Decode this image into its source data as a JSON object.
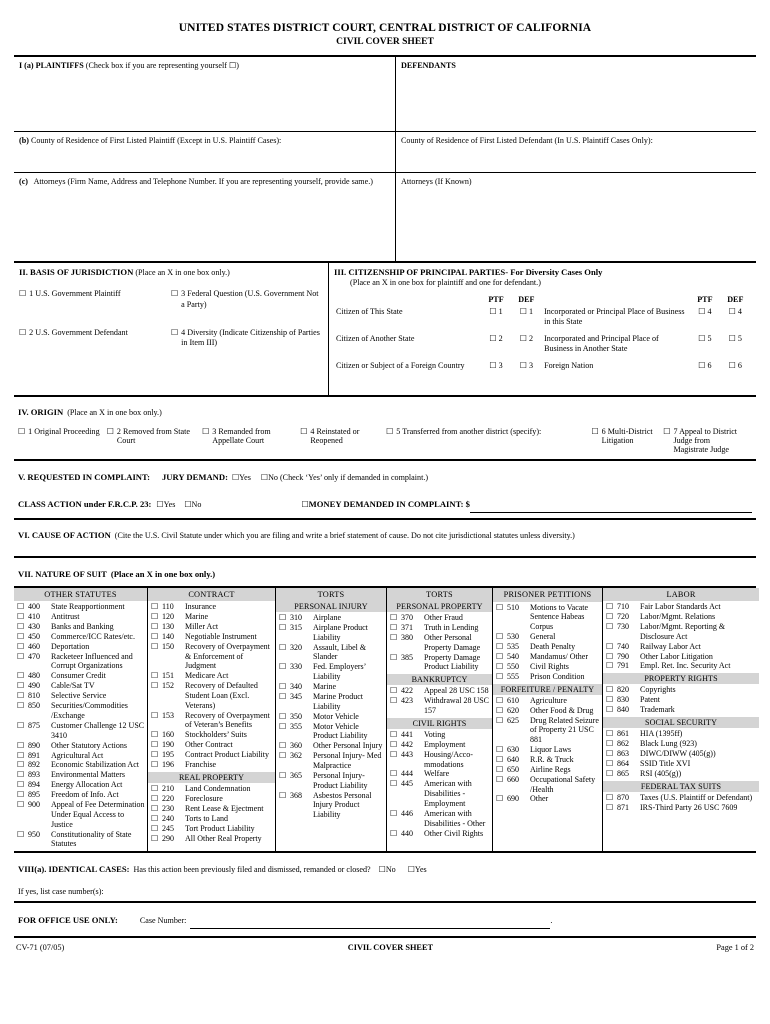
{
  "header": {
    "court": "UNITED STATES DISTRICT COURT, CENTRAL DISTRICT OF CALIFORNIA",
    "form_title": "CIVIL COVER SHEET"
  },
  "section_i": {
    "plaintiffs_label": "I (a) PLAINTIFFS",
    "plaintiffs_note": "(Check box if you are representing yourself ☐)",
    "defendants_label": "DEFENDANTS",
    "b_label": "(b)",
    "b_plaintiff": "County of Residence of First Listed Plaintiff (Except in U.S. Plaintiff Cases):",
    "b_defendant": "County of Residence of First Listed Defendant (In U.S. Plaintiff Cases Only):",
    "c_label": "(c)",
    "c_attorneys": "Attorneys (Firm Name, Address and Telephone Number. If you are representing yourself, provide same.)",
    "c_attorneys_def": "Attorneys (If Known)"
  },
  "section_ii": {
    "title": "II.  BASIS OF JURISDICTION",
    "instruction": "(Place an X in one box only.)",
    "options": [
      {
        "num": "1",
        "label": "U.S. Government Plaintiff"
      },
      {
        "num": "3",
        "label": "Federal Question (U.S. Government Not a Party)"
      },
      {
        "num": "2",
        "label": "U.S. Government Defendant"
      },
      {
        "num": "4",
        "label": "Diversity (Indicate Citizenship of Parties in Item III)"
      }
    ]
  },
  "section_iii": {
    "title": "III.  CITIZENSHIP OF PRINCIPAL PARTIES",
    "subtitle": "-  For Diversity Cases Only",
    "instruction": "(Place an X in one box for plaintiff and one for defendant.)",
    "ptf": "PTF",
    "def": "DEF",
    "rows": [
      {
        "left": "Citizen of This State",
        "lptf": "1",
        "ldef": "1",
        "right": "Incorporated or Principal Place of Business in this State",
        "rptf": "4",
        "rdef": "4"
      },
      {
        "left": "Citizen of Another State",
        "lptf": "2",
        "ldef": "2",
        "right": "Incorporated and Principal Place of Business in Another State",
        "rptf": "5",
        "rdef": "5"
      },
      {
        "left": "Citizen or Subject of a Foreign Country",
        "lptf": "3",
        "ldef": "3",
        "right": "Foreign Nation",
        "rptf": "6",
        "rdef": "6"
      }
    ]
  },
  "section_iv": {
    "title": "IV.  ORIGIN",
    "instruction": "(Place an X in one box only.)",
    "options": [
      {
        "num": "1",
        "label": "Original Proceeding"
      },
      {
        "num": "2",
        "label": "Removed from State Court"
      },
      {
        "num": "3",
        "label": "Remanded from Appellate Court"
      },
      {
        "num": "4",
        "label": "Reinstated or Reopened"
      },
      {
        "num": "5",
        "label": "Transferred from another district (specify):"
      },
      {
        "num": "6",
        "label": "Multi-District Litigation"
      },
      {
        "num": "7",
        "label": "Appeal to District Judge from Magistrate Judge"
      }
    ]
  },
  "section_v": {
    "title": "V.  REQUESTED IN COMPLAINT:",
    "jury_demand_label": "JURY DEMAND:",
    "yes": "Yes",
    "no": "No (Check ‘Yes’ only if demanded in complaint.)",
    "class_action_label": "CLASS ACTION under F.R.C.P. 23:",
    "class_yes": "Yes",
    "class_no": "No",
    "money_label": "MONEY DEMANDED IN COMPLAINT: $"
  },
  "section_vi": {
    "title": "VI. CAUSE OF ACTION",
    "instruction": "(Cite the U.S. Civil Statute under which you are filing and write a brief statement of cause.  Do not cite jurisdictional statutes unless diversity.)"
  },
  "section_vii": {
    "title": "VII.  NATURE OF SUIT",
    "instruction": "(Place an X in one box only.)",
    "columns": [
      {
        "heading": "OTHER STATUTES",
        "groups": [
          {
            "subhead": null,
            "items": [
              {
                "num": "400",
                "label": "State Reapportionment"
              },
              {
                "num": "410",
                "label": "Antitrust"
              },
              {
                "num": "430",
                "label": "Banks and Banking"
              },
              {
                "num": "450",
                "label": "Commerce/ICC Rates/etc."
              },
              {
                "num": "460",
                "label": "Deportation"
              },
              {
                "num": "470",
                "label": "Racketeer Influenced and Corrupt Organizations"
              },
              {
                "num": "480",
                "label": "Consumer Credit"
              },
              {
                "num": "490",
                "label": "Cable/Sat TV"
              },
              {
                "num": "810",
                "label": "Selective Service"
              },
              {
                "num": "850",
                "label": "Securities/Commodities /Exchange"
              },
              {
                "num": "875",
                "label": "Customer Challenge 12 USC 3410"
              },
              {
                "num": "890",
                "label": "Other Statutory Actions"
              },
              {
                "num": "891",
                "label": "Agricultural Act"
              },
              {
                "num": "892",
                "label": "Economic Stabilization Act"
              },
              {
                "num": "893",
                "label": "Environmental Matters"
              },
              {
                "num": "894",
                "label": "Energy Allocation Act"
              },
              {
                "num": "895",
                "label": "Freedom of Info. Act"
              },
              {
                "num": "900",
                "label": "Appeal of Fee Determination Under Equal Access to Justice"
              },
              {
                "num": "950",
                "label": "Constitutionality of State Statutes"
              }
            ]
          }
        ]
      },
      {
        "heading": "CONTRACT",
        "groups": [
          {
            "subhead": null,
            "items": [
              {
                "num": "110",
                "label": "Insurance"
              },
              {
                "num": "120",
                "label": "Marine"
              },
              {
                "num": "130",
                "label": "Miller Act"
              },
              {
                "num": "140",
                "label": "Negotiable Instrument"
              },
              {
                "num": "150",
                "label": "Recovery of Overpayment & Enforcement of Judgment"
              },
              {
                "num": "151",
                "label": "Medicare Act"
              },
              {
                "num": "152",
                "label": "Recovery of Defaulted Student Loan (Excl. Veterans)"
              },
              {
                "num": "153",
                "label": "Recovery of Overpayment of Veteran’s Benefits"
              },
              {
                "num": "160",
                "label": "Stockholders’ Suits"
              },
              {
                "num": "190",
                "label": "Other Contract"
              },
              {
                "num": "195",
                "label": "Contract Product Liability"
              },
              {
                "num": "196",
                "label": "Franchise"
              }
            ]
          },
          {
            "subhead": "REAL PROPERTY",
            "items": [
              {
                "num": "210",
                "label": "Land Condemnation"
              },
              {
                "num": "220",
                "label": "Foreclosure"
              },
              {
                "num": "230",
                "label": "Rent Lease & Ejectment"
              },
              {
                "num": "240",
                "label": "Torts to Land"
              },
              {
                "num": "245",
                "label": "Tort Product Liability"
              },
              {
                "num": "290",
                "label": "All Other Real Property"
              }
            ]
          }
        ]
      },
      {
        "heading": "TORTS",
        "groups": [
          {
            "subhead": "PERSONAL INJURY",
            "items": [
              {
                "num": "310",
                "label": "Airplane"
              },
              {
                "num": "315",
                "label": "Airplane Product Liability"
              },
              {
                "num": "320",
                "label": "Assault, Libel & Slander"
              },
              {
                "num": "330",
                "label": "Fed. Employers’ Liability"
              },
              {
                "num": "340",
                "label": "Marine"
              },
              {
                "num": "345",
                "label": "Marine Product Liability"
              },
              {
                "num": "350",
                "label": "Motor Vehicle"
              },
              {
                "num": "355",
                "label": "Motor Vehicle Product Liability"
              },
              {
                "num": "360",
                "label": "Other Personal Injury"
              },
              {
                "num": "362",
                "label": "Personal Injury- Med Malpractice"
              },
              {
                "num": "365",
                "label": "Personal Injury- Product Liability"
              },
              {
                "num": "368",
                "label": "Asbestos Personal Injury Product Liability"
              }
            ]
          }
        ]
      },
      {
        "heading": "TORTS",
        "groups": [
          {
            "subhead": "PERSONAL PROPERTY",
            "items": [
              {
                "num": "370",
                "label": "Other Fraud"
              },
              {
                "num": "371",
                "label": "Truth in Lending"
              },
              {
                "num": "380",
                "label": "Other Personal Property Damage"
              },
              {
                "num": "385",
                "label": "Property Damage Product Liability"
              }
            ]
          },
          {
            "subhead": "BANKRUPTCY",
            "items": [
              {
                "num": "422",
                "label": "Appeal 28 USC 158"
              },
              {
                "num": "423",
                "label": "Withdrawal 28 USC 157"
              }
            ]
          },
          {
            "subhead": "CIVIL RIGHTS",
            "items": [
              {
                "num": "441",
                "label": "Voting"
              },
              {
                "num": "442",
                "label": "Employment"
              },
              {
                "num": "443",
                "label": "Housing/Acco-mmodations"
              },
              {
                "num": "444",
                "label": "Welfare"
              },
              {
                "num": "445",
                "label": "American with Disabilities  - Employment"
              },
              {
                "num": "446",
                "label": "American with Disabilities - Other"
              },
              {
                "num": "440",
                "label": "Other Civil Rights"
              }
            ]
          }
        ]
      },
      {
        "heading": "PRISONER PETITIONS",
        "groups": [
          {
            "subhead": null,
            "items": [
              {
                "num": "510",
                "label": "Motions to Vacate Sentence Habeas Corpus"
              },
              {
                "num": "530",
                "label": "General"
              },
              {
                "num": "535",
                "label": "Death Penalty"
              },
              {
                "num": "540",
                "label": "Mandamus/ Other"
              },
              {
                "num": "550",
                "label": "Civil Rights"
              },
              {
                "num": "555",
                "label": "Prison Condition"
              }
            ]
          },
          {
            "subhead": "FORFEITURE / PENALTY",
            "items": [
              {
                "num": "610",
                "label": "Agriculture"
              },
              {
                "num": "620",
                "label": "Other Food & Drug"
              },
              {
                "num": "625",
                "label": "Drug Related Seizure of Property 21 USC 881"
              },
              {
                "num": "630",
                "label": "Liquor Laws"
              },
              {
                "num": "640",
                "label": "R.R. & Truck"
              },
              {
                "num": "650",
                "label": "Airline Regs"
              },
              {
                "num": "660",
                "label": "Occupational Safety /Health"
              },
              {
                "num": "690",
                "label": "Other"
              }
            ]
          }
        ]
      },
      {
        "heading": "LABOR",
        "groups": [
          {
            "subhead": null,
            "items": [
              {
                "num": "710",
                "label": "Fair Labor Standards Act"
              },
              {
                "num": "720",
                "label": "Labor/Mgmt. Relations"
              },
              {
                "num": "730",
                "label": "Labor/Mgmt. Reporting & Disclosure Act"
              },
              {
                "num": "740",
                "label": "Railway Labor Act"
              },
              {
                "num": "790",
                "label": "Other Labor Litigation"
              },
              {
                "num": "791",
                "label": "Empl. Ret. Inc. Security Act"
              }
            ]
          },
          {
            "subhead": "PROPERTY RIGHTS",
            "items": [
              {
                "num": "820",
                "label": "Copyrights"
              },
              {
                "num": "830",
                "label": "Patent"
              },
              {
                "num": "840",
                "label": "Trademark"
              }
            ]
          },
          {
            "subhead": "SOCIAL SECURITY",
            "items": [
              {
                "num": "861",
                "label": "HIA (1395ff)"
              },
              {
                "num": "862",
                "label": "Black Lung (923)"
              },
              {
                "num": "863",
                "label": "DIWC/DIWW (405(g))"
              },
              {
                "num": "864",
                "label": "SSID Title XVI"
              },
              {
                "num": "865",
                "label": "RSI (405(g))"
              }
            ]
          },
          {
            "subhead": "FEDERAL TAX SUITS",
            "items": [
              {
                "num": "870",
                "label": "Taxes (U.S. Plaintiff or Defendant)"
              },
              {
                "num": "871",
                "label": "IRS-Third Party 26 USC 7609"
              }
            ]
          }
        ]
      }
    ]
  },
  "section_viii": {
    "title": "VIII(a).  IDENTICAL CASES:",
    "question": "Has this action been previously filed and dismissed, remanded or closed?",
    "no": "No",
    "yes": "Yes",
    "if_yes": "If yes, list case number(s):"
  },
  "office_use": {
    "label": "FOR OFFICE USE ONLY:",
    "case_number_label": "Case Number:",
    "trailing": "."
  },
  "footer": {
    "form_number": "CV-71 (07/05)",
    "center": "CIVIL COVER SHEET",
    "page": "Page 1 of 2"
  }
}
